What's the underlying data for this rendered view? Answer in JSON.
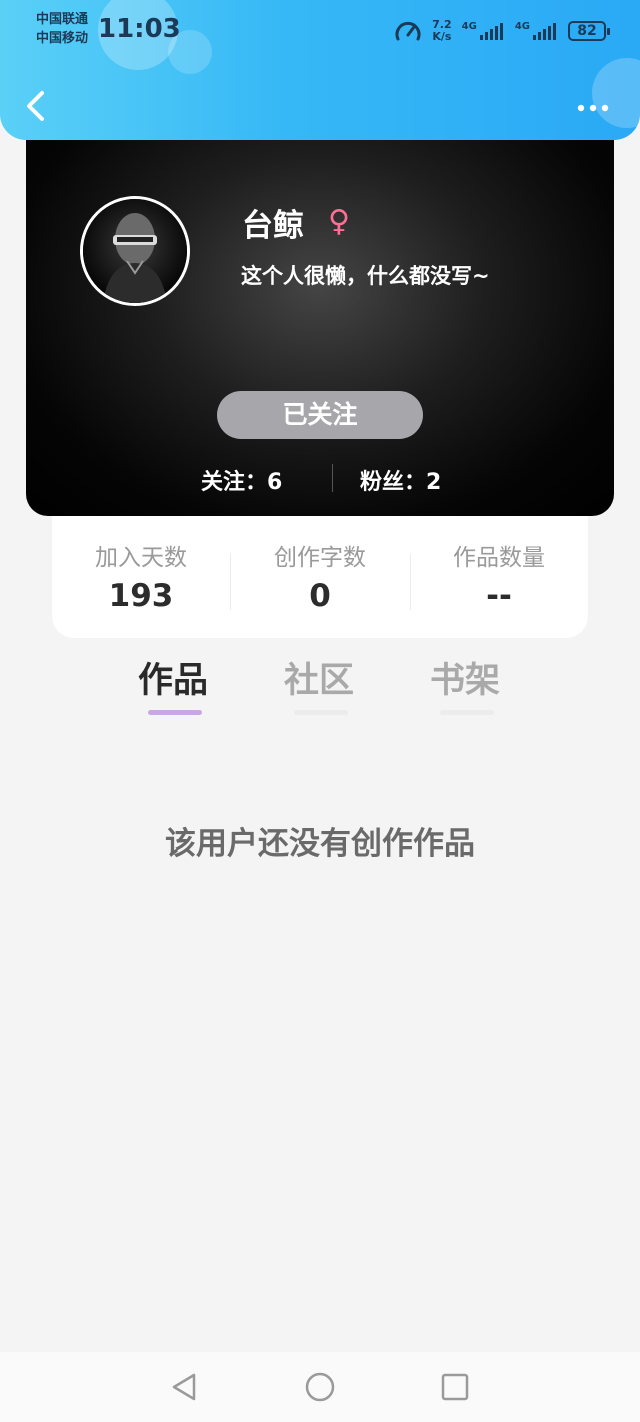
{
  "status_bar": {
    "carrier_1": "中国联通",
    "carrier_2": "中国移动",
    "time": "11:03",
    "net_speed_value": "7.2",
    "net_speed_unit": "K/s",
    "signal_1_label": "4G",
    "signal_2_label": "4G",
    "battery": "82"
  },
  "header": {
    "back_icon": "chevron-left-icon",
    "more_icon": "more-dots-icon"
  },
  "profile": {
    "name": "台鲸",
    "gender_symbol": "♀",
    "bio": "这个人很懒，什么都没写~",
    "follow_button": "已关注",
    "following_label": "关注：",
    "following_count": "6",
    "followers_label": "粉丝：",
    "followers_count": "2"
  },
  "stats": [
    {
      "label": "加入天数",
      "value": "193"
    },
    {
      "label": "创作字数",
      "value": "0"
    },
    {
      "label": "作品数量",
      "value": "--"
    }
  ],
  "tabs": [
    {
      "label": "作品",
      "active": true
    },
    {
      "label": "社区",
      "active": false
    },
    {
      "label": "书架",
      "active": false
    }
  ],
  "empty_message": "该用户还没有创作作品",
  "colors": {
    "header_gradient_start": "#5ad0f7",
    "header_gradient_end": "#2aa9f5",
    "gender_color": "#ff6f95",
    "active_tab_indicator": "#c9a6e6",
    "follow_button_bg": "#a7a6ab"
  }
}
